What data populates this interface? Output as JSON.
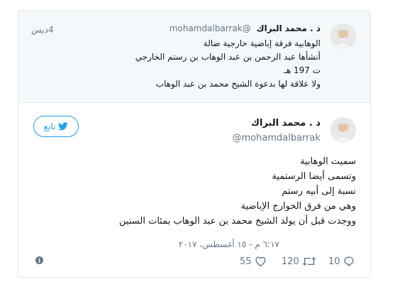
{
  "quoted": {
    "name": "د . محمد البراك",
    "handle": "@mohamdalbarrak",
    "time": "4ديس",
    "lines": [
      "الوهابية فرقة إباضية خارجية ضالة",
      "أنشأها عبد الرحمن بن عبد الوهاب بن رستم الخارجي",
      "ت 197 هـ",
      "ولا علاقة لها بدعوة الشيخ محمد بن عبد الوهاب"
    ]
  },
  "main": {
    "name": "د . محمد البراك",
    "handle": "@mohamdalbarrak",
    "follow_label": "تابع",
    "lines": [
      "سميت الوهابية",
      "وتسمى أيضا الرستمية",
      "نسبة إلى أبيه رستم",
      "وهي من فرق الخوارج الإباضية",
      "ووجدت قبل أن يولد الشيخ محمد بن عبد الوهاب بمئات السنين"
    ],
    "timestamp": "٦:١٧ م - ١٥ أغسطس، ٢٠١٧",
    "replies": "10",
    "retweets": "120",
    "likes": "55"
  },
  "icons": {
    "reply": "reply-icon",
    "retweet": "retweet-icon",
    "like": "heart-icon",
    "info": "info-icon",
    "bird": "twitter-bird-icon"
  },
  "colors": {
    "accent": "#1da1f2",
    "muted": "#657786",
    "quoted_bg": "#f5f8fa"
  }
}
